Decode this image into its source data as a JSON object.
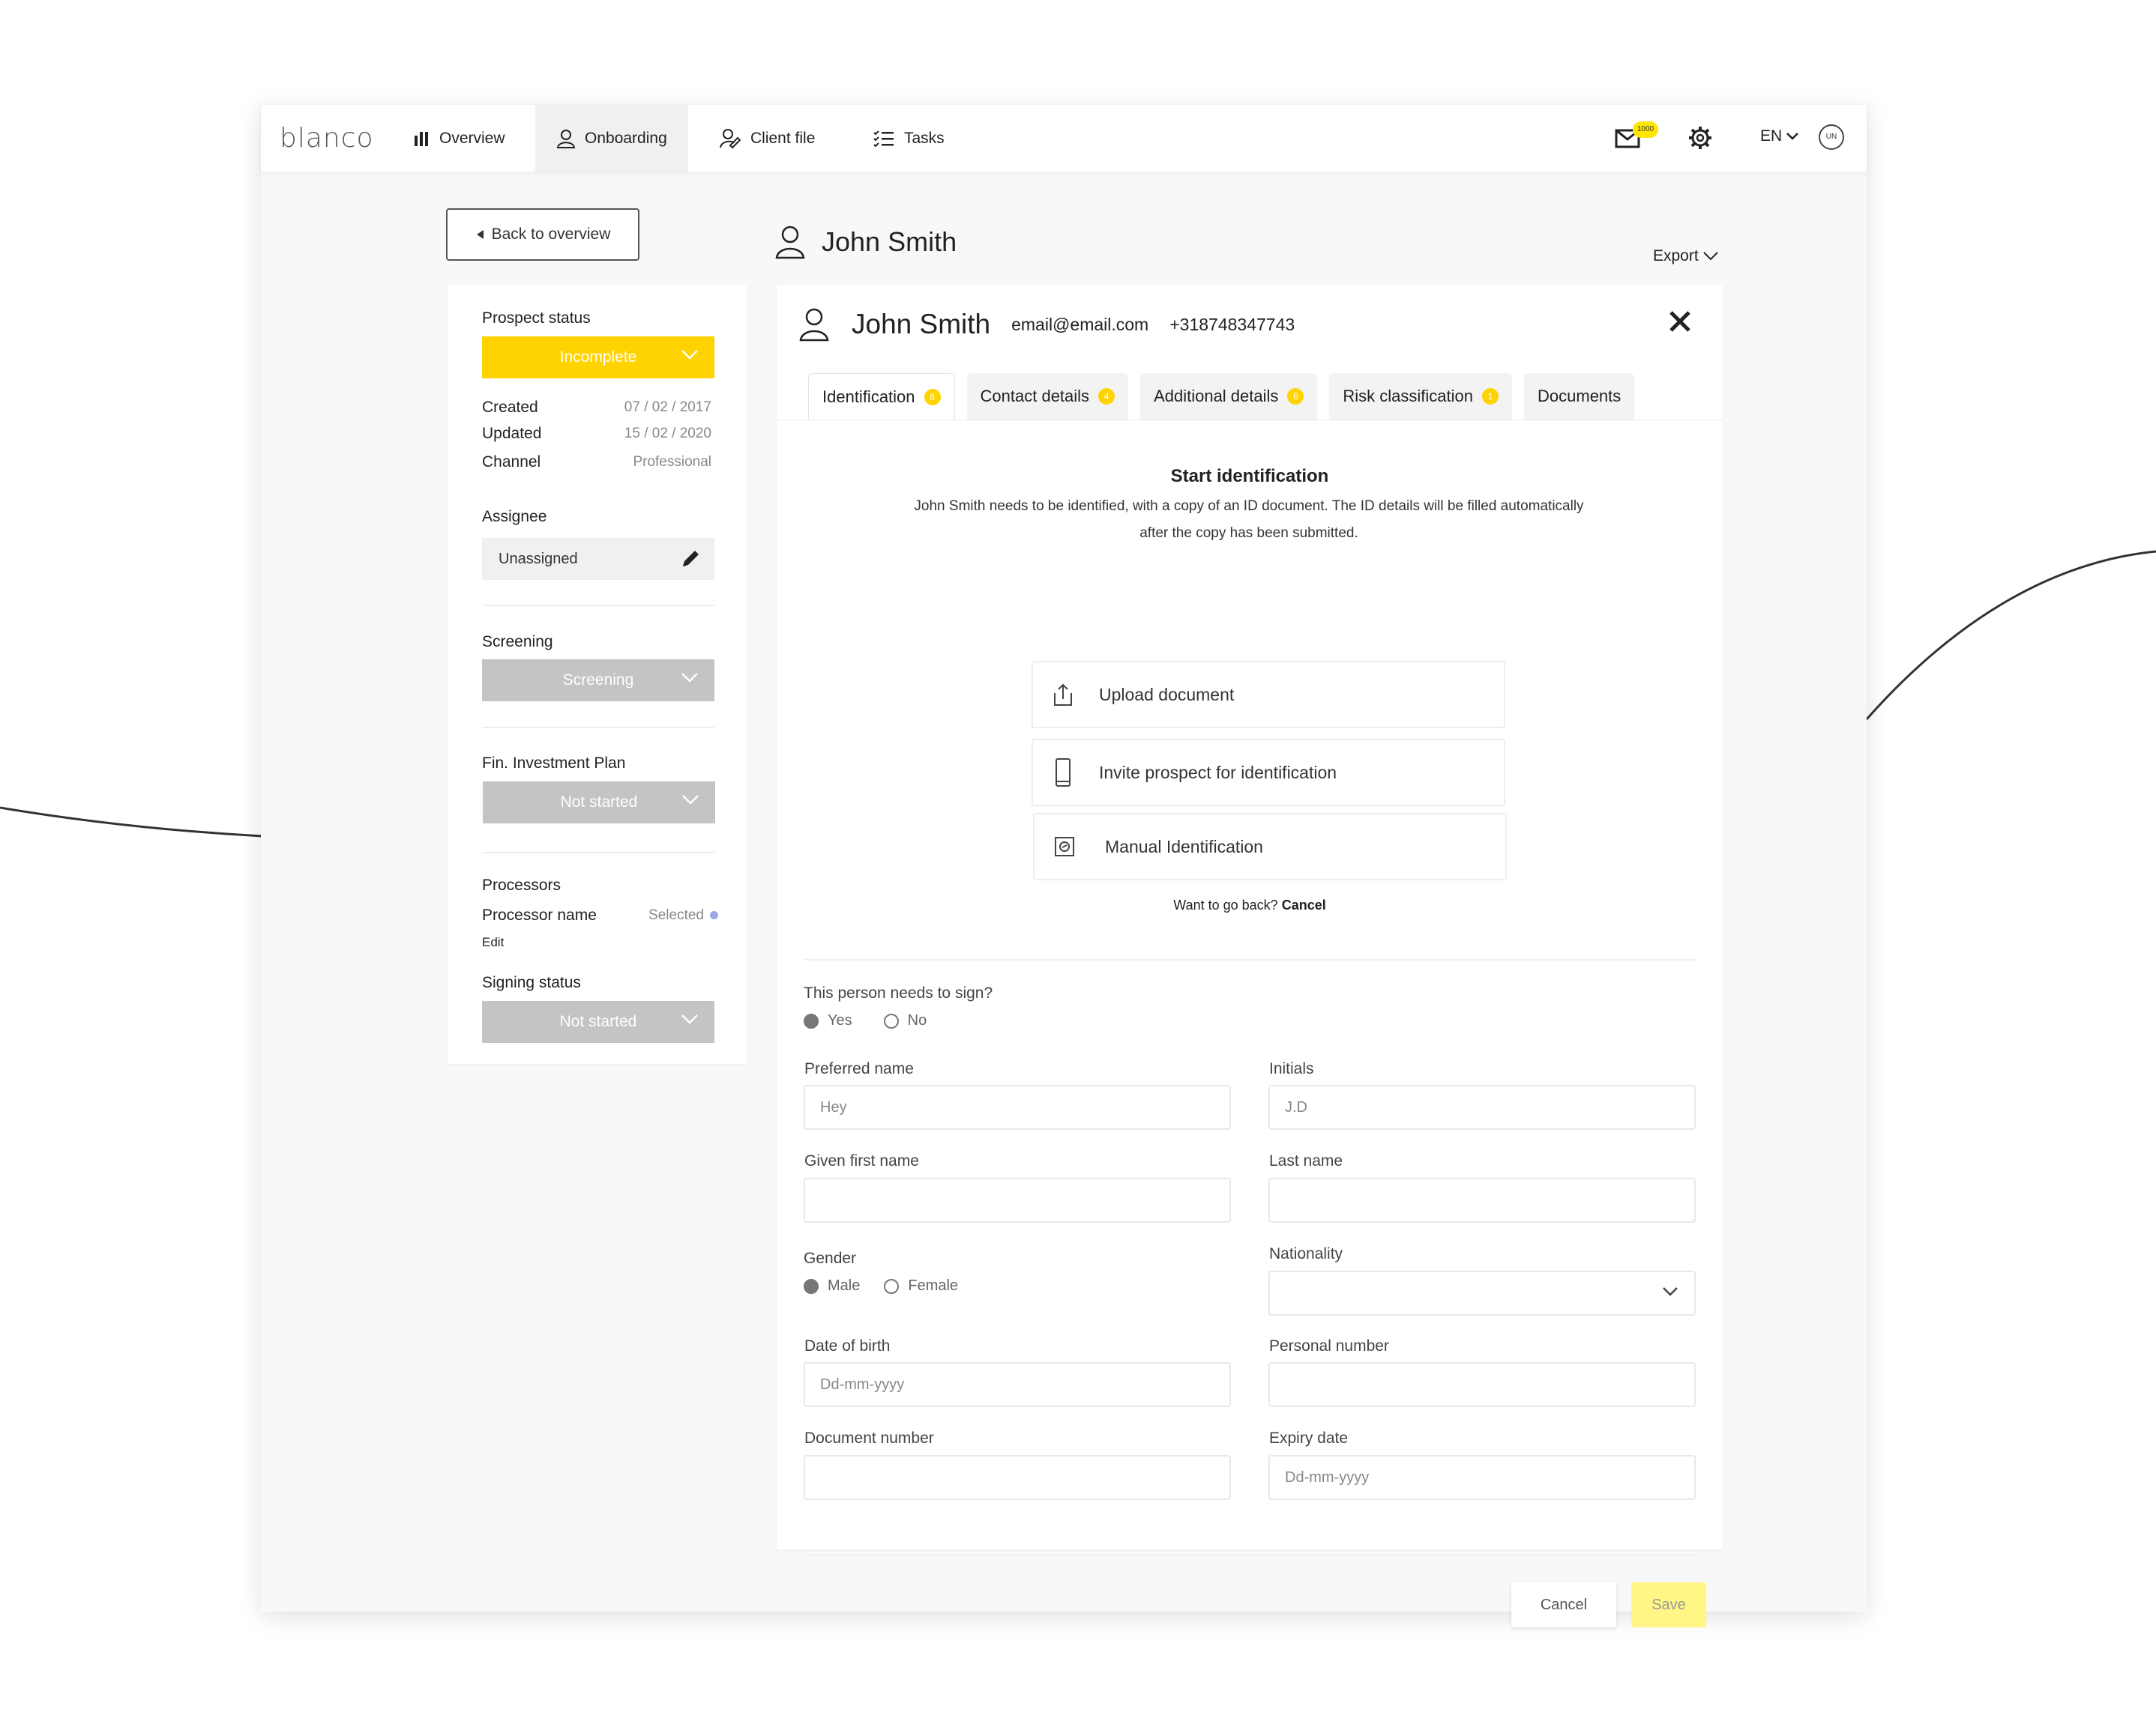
{
  "nav": {
    "logo": "blanco",
    "items": [
      {
        "label": "Overview",
        "icon": "bar-chart-icon"
      },
      {
        "label": "Onboarding",
        "icon": "user-icon"
      },
      {
        "label": "Client file",
        "icon": "user-edit-icon"
      },
      {
        "label": "Tasks",
        "icon": "checklist-icon"
      }
    ],
    "active": "Onboarding",
    "mail_badge": "1000",
    "language": "EN",
    "user_initials": "UN"
  },
  "back_button": "Back to overview",
  "page_title": "John Smith",
  "export_label": "Export",
  "sidebar": {
    "prospect_status_label": "Prospect status",
    "prospect_status_value": "Incomplete",
    "created_label": "Created",
    "created_value": "07 / 02 / 2017",
    "updated_label": "Updated",
    "updated_value": "15 / 02 / 2020",
    "channel_label": "Channel",
    "channel_value": "Professional",
    "assignee_label": "Assignee",
    "assignee_value": "Unassigned",
    "screening_label": "Screening",
    "screening_value": "Screening",
    "fip_label": "Fin. Investment Plan",
    "fip_value": "Not started",
    "processors_label": "Processors",
    "processor_name_label": "Processor name",
    "processor_name_value": "Selected",
    "edit_label": "Edit",
    "signing_label": "Signing status",
    "signing_value": "Not started"
  },
  "card": {
    "name": "John Smith",
    "email": "email@email.com",
    "phone": "+318748347743",
    "tabs": [
      {
        "label": "Identification",
        "badge": "8"
      },
      {
        "label": "Contact details",
        "badge": "4"
      },
      {
        "label": "Additional details",
        "badge": "6"
      },
      {
        "label": "Risk classification",
        "badge": "1"
      },
      {
        "label": "Documents",
        "badge": ""
      }
    ],
    "start_title": "Start identification",
    "start_desc": "John Smith needs to be identified, with a copy of an ID document. The ID details will be filled automatically after the copy has been submitted.",
    "options": [
      {
        "label": "Upload document",
        "icon": "upload-icon"
      },
      {
        "label": "Invite prospect for identification",
        "icon": "phone-icon"
      },
      {
        "label": "Manual Identification",
        "icon": "id-card-icon"
      }
    ],
    "goback_text": "Want to go back?",
    "goback_link": "Cancel"
  },
  "form": {
    "sign_question": "This person needs to sign?",
    "sign_yes": "Yes",
    "sign_no": "No",
    "preferred_name_label": "Preferred name",
    "preferred_name_value": "Hey",
    "initials_label": "Initials",
    "initials_value": "J.D",
    "given_first_name_label": "Given first name",
    "given_first_name_value": "",
    "last_name_label": "Last name",
    "last_name_value": "",
    "gender_label": "Gender",
    "gender_male": "Male",
    "gender_female": "Female",
    "nationality_label": "Nationality",
    "nationality_value": "",
    "dob_label": "Date of birth",
    "dob_placeholder": "Dd-mm-yyyy",
    "personal_number_label": "Personal number",
    "personal_number_value": "",
    "document_number_label": "Document number",
    "document_number_value": "",
    "expiry_label": "Expiry date",
    "expiry_placeholder": "Dd-mm-yyyy",
    "cancel_label": "Cancel",
    "save_label": "Save"
  },
  "colors": {
    "accent": "#ffd300",
    "disabled": "#c4c4c4",
    "save_button": "#fff685"
  }
}
